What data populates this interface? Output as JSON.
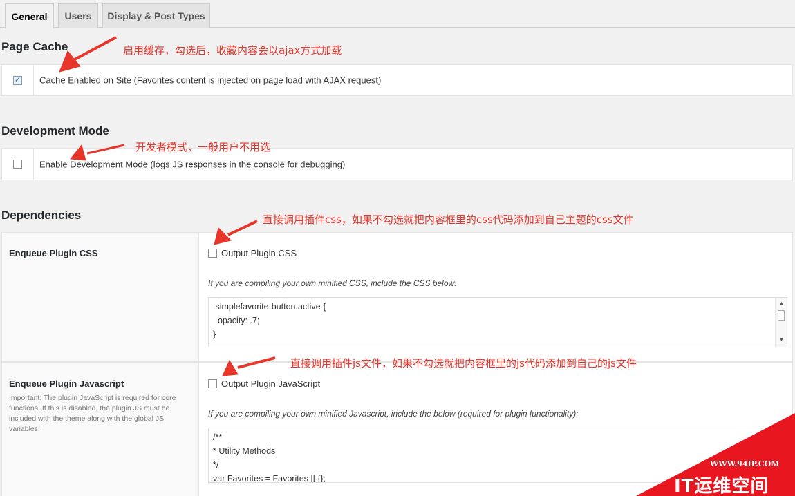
{
  "tabs": [
    {
      "label": "General",
      "active": true
    },
    {
      "label": "Users",
      "active": false
    },
    {
      "label": "Display & Post Types",
      "active": false
    }
  ],
  "page_cache": {
    "title": "Page Cache",
    "checkbox_label": "Cache Enabled on Site (Favorites content is injected on page load with AJAX request)",
    "checked": true,
    "annotation": "启用缓存，勾选后，收藏内容会以ajax方式加载"
  },
  "dev_mode": {
    "title": "Development Mode",
    "checkbox_label": "Enable Development Mode (logs JS responses in the console for debugging)",
    "checked": false,
    "annotation": "开发者模式，一般用户不用选"
  },
  "dependencies": {
    "title": "Dependencies",
    "css": {
      "title": "Enqueue Plugin CSS",
      "option_label": "Output Plugin CSS",
      "checked": false,
      "hint": "If you are compiling your own minified CSS, include the CSS below:",
      "code": [
        ".simplefavorite-button.active {",
        "  opacity: .7;",
        "}"
      ],
      "annotation": "直接调用插件css，如果不勾选就把内容框里的css代码添加到自己主题的css文件"
    },
    "js": {
      "title": "Enqueue Plugin Javascript",
      "description": "Important: The plugin JavaScript is required for core functions. If this is disabled, the plugin JS must be included with the theme along with the global JS variables.",
      "option_label": "Output Plugin JavaScript",
      "checked": false,
      "hint": "If you are compiling your own minified Javascript, include the below (required for plugin functionality):",
      "code": [
        "/**",
        "* Utility Methods",
        "*/",
        "var Favorites = Favorites || {};"
      ],
      "annotation": "直接调用插件js文件，如果不勾选就把内容框里的js代码添加到自己的js文件"
    }
  },
  "watermark": {
    "url": "WWW.94IP.COM",
    "brand": "IT运维空间",
    "color": "#e8161f"
  },
  "colors": {
    "annotation": "#e8352a",
    "background": "#f1f1f1"
  }
}
